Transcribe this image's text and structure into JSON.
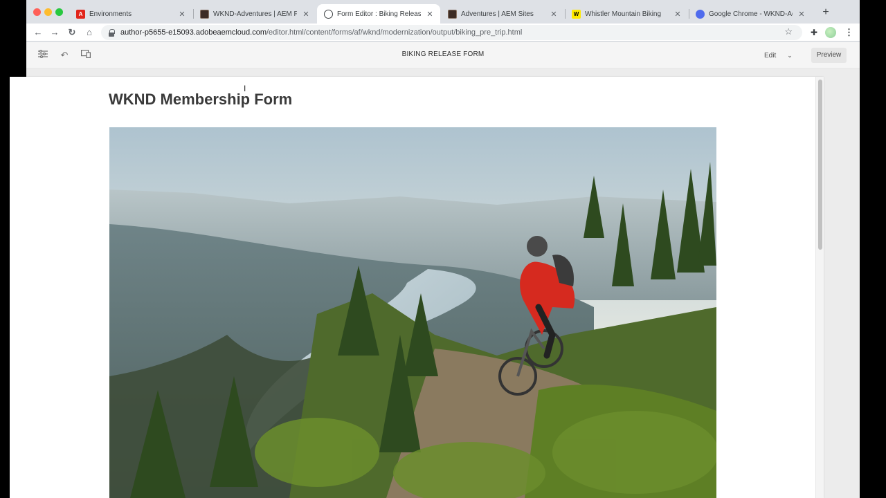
{
  "browser": {
    "tabs": [
      {
        "title": "Environments",
        "favicon": "adobe-icon",
        "color": "#e1251b"
      },
      {
        "title": "WKND-Adventures | AEM Forms",
        "favicon": "aem-icon",
        "color": "#3d2c25"
      },
      {
        "title": "Form Editor : Biking Release Form",
        "favicon": "globe-icon",
        "color": "#3c4043"
      },
      {
        "title": "Adventures | AEM Sites",
        "favicon": "aem-icon",
        "color": "#3d2c25"
      },
      {
        "title": "Whistler Mountain Biking",
        "favicon": "wknd-icon",
        "color": "#ffea00"
      },
      {
        "title": "Google Chrome - WKND-Adventures",
        "favicon": "chrome-gear-icon",
        "color": "#4f6bed"
      }
    ],
    "active_tab_index": 2,
    "url_host": "author-p5655-e15093.adobeaemcloud.com",
    "url_path": "/editor.html/content/forms/af/wknd/modernization/output/biking_pre_trip.html"
  },
  "editor": {
    "title": "BIKING RELEASE FORM",
    "mode": "Edit",
    "preview_label": "Preview"
  },
  "form": {
    "heading": "WKND Membership Form",
    "hero_image": "mountain-biker-on-ridge-above-lake"
  },
  "colors": {
    "tab_strip": "#dee1e6",
    "accent_red": "#e1251b"
  }
}
